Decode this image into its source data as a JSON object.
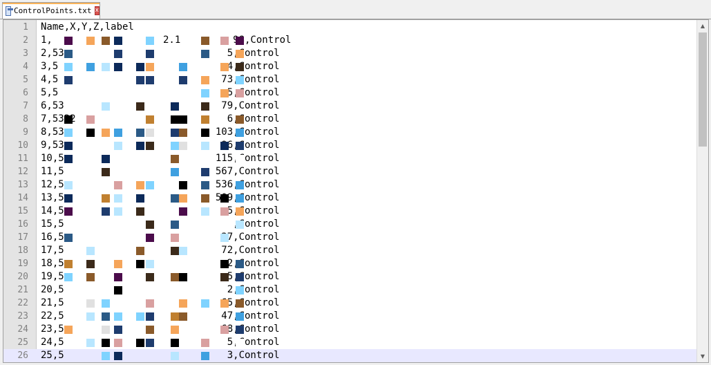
{
  "tab": {
    "filename": "ControlPoints.txt",
    "close_icon": "close-icon",
    "file_icon": "save-icon"
  },
  "lines": [
    {
      "n": "1",
      "text": "Name,X,Y,Z,label"
    },
    {
      "n": "2",
      "text": "1,                   2.1         98,Control"
    },
    {
      "n": "3",
      "text": "2,53                            5,Control"
    },
    {
      "n": "4",
      "text": "3,5                             4,Control"
    },
    {
      "n": "5",
      "text": "4,5                            73,Control"
    },
    {
      "n": "6",
      "text": "5,5                             5,Control"
    },
    {
      "n": "7",
      "text": "6,53                           79,Control"
    },
    {
      "n": "8",
      "text": "7,5322                          6,Control"
    },
    {
      "n": "9",
      "text": "8,53                          103,Control"
    },
    {
      "n": "10",
      "text": "9,53                           96,Control"
    },
    {
      "n": "11",
      "text": "10,5                          115,Control"
    },
    {
      "n": "12",
      "text": "11,5                          567,Control"
    },
    {
      "n": "13",
      "text": "12,5                          536,Control"
    },
    {
      "n": "14",
      "text": "13,5                          509,Control"
    },
    {
      "n": "15",
      "text": "14,5                            5,Control"
    },
    {
      "n": "16",
      "text": "15,5                             ,Control"
    },
    {
      "n": "17",
      "text": "16,5                           37,Control"
    },
    {
      "n": "18",
      "text": "17,5                           72,Control"
    },
    {
      "n": "19",
      "text": "18,5                            2,Control"
    },
    {
      "n": "20",
      "text": "19,5                            5,Control"
    },
    {
      "n": "21",
      "text": "20,5                            2,Control"
    },
    {
      "n": "22",
      "text": "21,5                           65,Control"
    },
    {
      "n": "23",
      "text": "22,5                           47,Control"
    },
    {
      "n": "24",
      "text": "23,5                           68,Control"
    },
    {
      "n": "25",
      "text": "24,5                            5,Control"
    },
    {
      "n": "26",
      "text": "25,5                            3,Control"
    }
  ]
}
